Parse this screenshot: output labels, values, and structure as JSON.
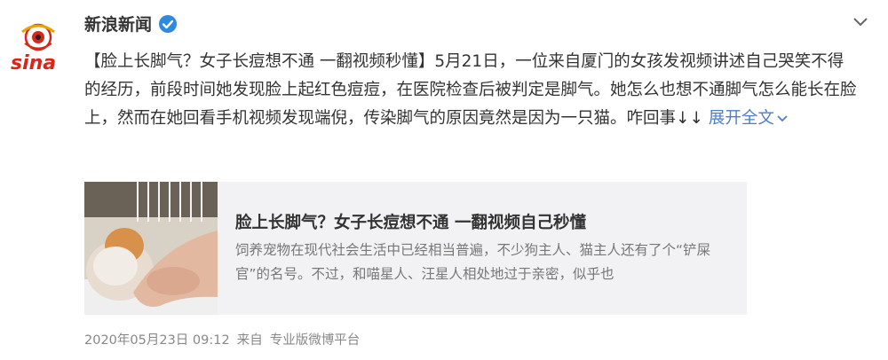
{
  "account": {
    "name": "新浪新闻",
    "logo_text": "sina",
    "verified_badge": "verified-check-icon"
  },
  "post": {
    "text": "【脸上长脚气？女子长痘想不通 一翻视频秒懂】5月21日，一位来自厦门的女孩发视频讲述自己哭笑不得的经历，前段时间她发现脸上起红色痘痘，在医院检查后被判定是脚气。她怎么也想不通脚气怎么能长在脸上，然而在她回看手机视频发现端倪，传染脚气的原因竟然是因为一只猫。咋回事↓↓ ",
    "expand_label": "展开全文"
  },
  "card": {
    "title": "脸上长脚气？女子长痘想不通 一翻视频自己秒懂",
    "description": "饲养宠物在现代社会生活中已经相当普遍，不少狗主人、猫主人还有了个“铲屎官”的名号。不过，和喵星人、汪星人相处地过于亲密，似乎也"
  },
  "meta": {
    "timestamp": "2020年05月23日 09:12",
    "source_prefix": "来自",
    "source": "专业版微博平台"
  },
  "colors": {
    "link": "#4f7dc8",
    "logo_red": "#d9261c",
    "verified_blue": "#2d8ae0",
    "card_bg": "#f2f2f5"
  }
}
